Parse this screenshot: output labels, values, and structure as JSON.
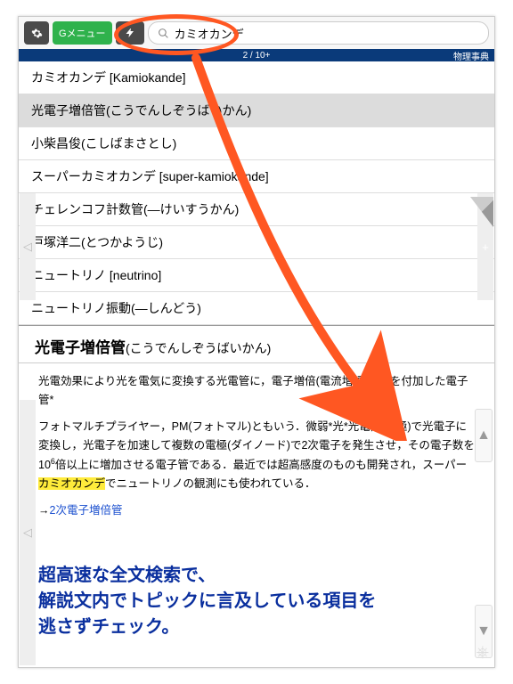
{
  "toolbar": {
    "menu_label": "Gメニュー",
    "search_value": "カミオカンデ"
  },
  "statusbar": {
    "pager": "2 / 10+",
    "dict_name": "物理事典"
  },
  "list": {
    "items": [
      {
        "label": "カミオカンデ [Kamiokande]",
        "selected": false
      },
      {
        "label": "光電子増倍管(こうでんしぞうばいかん)",
        "selected": true
      },
      {
        "label": "小柴昌俊(こしばまさとし)",
        "selected": false
      },
      {
        "label": "スーパーカミオカンデ [super-kamiokande]",
        "selected": false
      },
      {
        "label": "チェレンコフ計数管(—けいすうかん)",
        "selected": false
      },
      {
        "label": "戸塚洋二(とつかようじ)",
        "selected": false
      },
      {
        "label": "ニュートリノ [neutrino]",
        "selected": false
      },
      {
        "label": "ニュートリノ振動(—しんどう)",
        "selected": false
      }
    ]
  },
  "detail": {
    "title": "光電子増倍管",
    "reading": "(こうでんしぞうばいかん)",
    "para1": "光電効果により光を電気に変換する光電管に，電子増倍(電流増幅)電極を付加した電子管*",
    "para2_a": "フォトマルチプライヤー，PM(フォトマル)ともいう．微弱*光*光電面(陰極)で光電子に変換し，光電子を加速して複数の電極(ダイノード)で2次電子を発生させ，その電子数を10",
    "para2_sup": "6",
    "para2_b": "倍以上に増加させる電子管である．最近では超高感度のものも開発され，スーパー",
    "para2_hl": "カミオカンデ",
    "para2_c": "でニュートリノの観測にも使われている．",
    "xref_arrow": "→",
    "xref_label": "2次電子増倍管"
  },
  "promo": {
    "line1": "超高速な全文検索で、",
    "line2": "解説文内でトピックに言及している項目を",
    "line3": "逃さずチェック。"
  },
  "icons": {
    "gear": "gear-icon",
    "bolt": "bolt-icon",
    "search": "search-icon",
    "up": "▲",
    "down": "▼",
    "tri": "◁",
    "plus": "+",
    "ship": "⎈"
  }
}
